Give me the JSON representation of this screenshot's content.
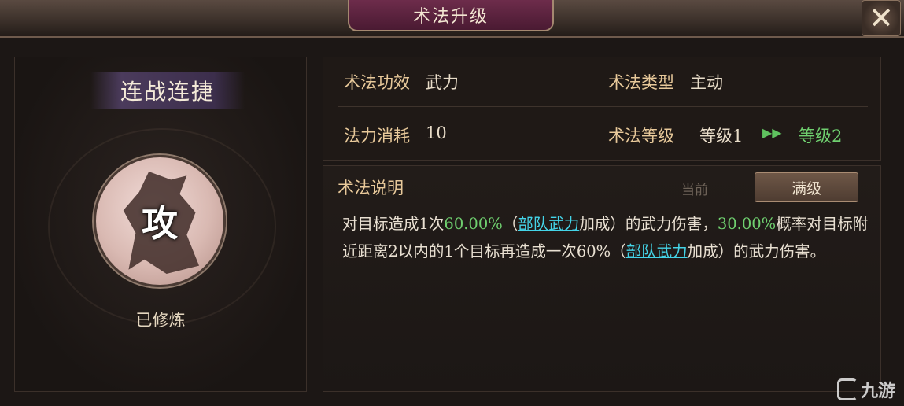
{
  "header": {
    "title": "术法升级",
    "close_icon": "close-icon"
  },
  "skill": {
    "name": "连战连捷",
    "icon_glyph": "攻",
    "status": "已修炼"
  },
  "info": {
    "effect_label": "术法功效",
    "effect_value": "武力",
    "type_label": "术法类型",
    "type_value": "主动",
    "cost_label": "法力消耗",
    "cost_value": "10",
    "level_label": "术法等级",
    "level_current": "等级1",
    "level_arrow": "▶▶",
    "level_next": "等级2"
  },
  "description": {
    "title": "术法说明",
    "tab_current": "当前",
    "tab_max": "满级",
    "parts": {
      "p1": "对目标造成1次",
      "p2": "60.00%",
      "p3": "（",
      "p4": "部队武力",
      "p5": "加成）的武力伤害，",
      "p6": "30.00%",
      "p7": "概率对目标附近距离2以内的1个目标再造成一次60%（",
      "p8": "部队武力",
      "p9": "加成）的武力伤害。"
    }
  },
  "watermark": {
    "text": "九游"
  },
  "colors": {
    "accent_gold": "#e8c99a",
    "highlight_green": "#6fcf6f",
    "link_cyan": "#44d4e8",
    "title_plate": "#6d2c4b"
  }
}
